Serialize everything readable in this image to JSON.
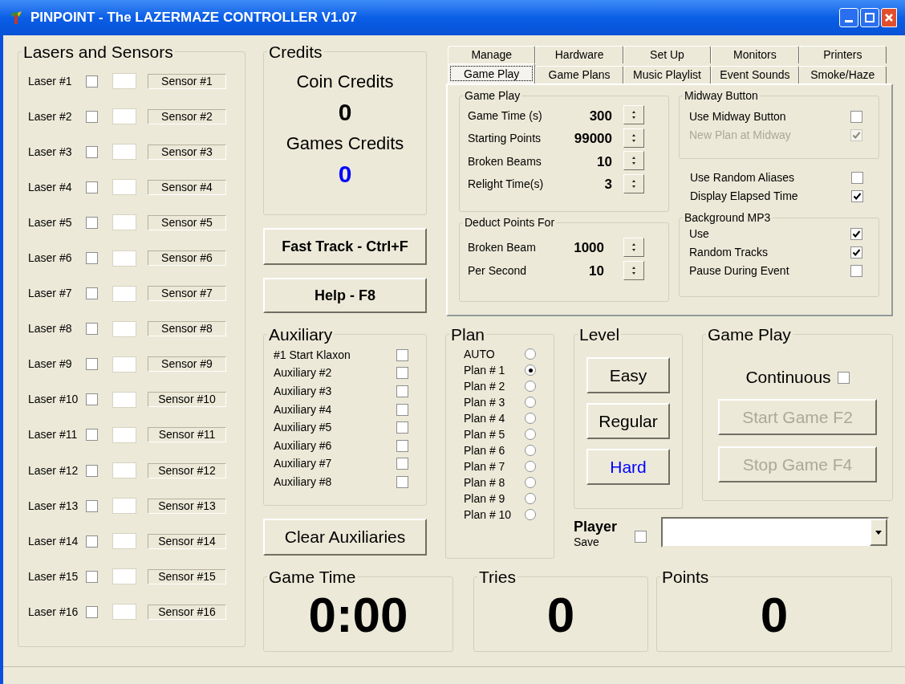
{
  "window": {
    "title": "PINPOINT - The LAZERMAZE CONTROLLER V1.07"
  },
  "lasers_and_sensors": {
    "title": "Lasers and Sensors",
    "rows": [
      {
        "laser": "Laser #1",
        "checked": false,
        "sensor": "Sensor #1"
      },
      {
        "laser": "Laser #2",
        "checked": false,
        "sensor": "Sensor #2"
      },
      {
        "laser": "Laser #3",
        "checked": false,
        "sensor": "Sensor #3"
      },
      {
        "laser": "Laser #4",
        "checked": false,
        "sensor": "Sensor #4"
      },
      {
        "laser": "Laser #5",
        "checked": false,
        "sensor": "Sensor #5"
      },
      {
        "laser": "Laser #6",
        "checked": false,
        "sensor": "Sensor #6"
      },
      {
        "laser": "Laser #7",
        "checked": false,
        "sensor": "Sensor #7"
      },
      {
        "laser": "Laser #8",
        "checked": false,
        "sensor": "Sensor #8"
      },
      {
        "laser": "Laser #9",
        "checked": false,
        "sensor": "Sensor #9"
      },
      {
        "laser": "Laser #10",
        "checked": false,
        "sensor": "Sensor #10"
      },
      {
        "laser": "Laser #11",
        "checked": false,
        "sensor": "Sensor #11"
      },
      {
        "laser": "Laser #12",
        "checked": false,
        "sensor": "Sensor #12"
      },
      {
        "laser": "Laser #13",
        "checked": false,
        "sensor": "Sensor #13"
      },
      {
        "laser": "Laser #14",
        "checked": false,
        "sensor": "Sensor #14"
      },
      {
        "laser": "Laser #15",
        "checked": false,
        "sensor": "Sensor #15"
      },
      {
        "laser": "Laser #16",
        "checked": false,
        "sensor": "Sensor #16"
      }
    ]
  },
  "credits": {
    "title": "Credits",
    "coin_label": "Coin Credits",
    "coin_value": "0",
    "games_label": "Games Credits",
    "games_value": "0"
  },
  "fast_track_button": "Fast Track - Ctrl+F",
  "help_button": "Help - F8",
  "tab_rows": [
    [
      {
        "label": "Manage",
        "selected": false
      },
      {
        "label": "Hardware",
        "selected": false
      },
      {
        "label": "Set Up",
        "selected": false
      },
      {
        "label": "Monitors",
        "selected": false
      },
      {
        "label": "Printers",
        "selected": false
      }
    ],
    [
      {
        "label": "Game Play",
        "selected": true
      },
      {
        "label": "Game Plans",
        "selected": false
      },
      {
        "label": "Music Playlist",
        "selected": false
      },
      {
        "label": "Event Sounds",
        "selected": false
      },
      {
        "label": "Smoke/Haze",
        "selected": false
      }
    ]
  ],
  "tab_panel": {
    "game_play": {
      "title": "Game Play",
      "fields": [
        {
          "label": "Game Time (s)",
          "value": "300"
        },
        {
          "label": "Starting Points",
          "value": "99000"
        },
        {
          "label": "Broken Beams",
          "value": "10"
        },
        {
          "label": "Relight Time(s)",
          "value": "3"
        }
      ]
    },
    "deduct_points": {
      "title": "Deduct Points For",
      "fields": [
        {
          "label": "Broken Beam",
          "value": "1000"
        },
        {
          "label": "Per Second",
          "value": "10"
        }
      ]
    },
    "midway_button": {
      "title": "Midway Button",
      "options": [
        {
          "label": "Use Midway Button",
          "checked": false,
          "disabled": false
        },
        {
          "label": "New Plan at Midway",
          "checked": true,
          "disabled": true
        }
      ]
    },
    "options": [
      {
        "label": "Use Random Aliases",
        "checked": false
      },
      {
        "label": "Display Elapsed Time",
        "checked": true
      }
    ],
    "background_mp3": {
      "title": "Background MP3",
      "options": [
        {
          "label": "Use",
          "checked": true
        },
        {
          "label": "Random Tracks",
          "checked": true
        },
        {
          "label": "Pause During Event",
          "checked": false
        }
      ]
    }
  },
  "auxiliary": {
    "title": "Auxiliary",
    "items": [
      {
        "label": "#1 Start Klaxon",
        "checked": false
      },
      {
        "label": "Auxiliary #2",
        "checked": false
      },
      {
        "label": "Auxiliary #3",
        "checked": false
      },
      {
        "label": "Auxiliary #4",
        "checked": false
      },
      {
        "label": "Auxiliary #5",
        "checked": false
      },
      {
        "label": "Auxiliary #6",
        "checked": false
      },
      {
        "label": "Auxiliary #7",
        "checked": false
      },
      {
        "label": "Auxiliary #8",
        "checked": false
      }
    ]
  },
  "clear_auxiliaries_button": "Clear Auxiliaries",
  "plan": {
    "title": "Plan",
    "items": [
      {
        "label": "AUTO",
        "selected": false
      },
      {
        "label": "Plan # 1",
        "selected": true
      },
      {
        "label": "Plan # 2",
        "selected": false
      },
      {
        "label": "Plan # 3",
        "selected": false
      },
      {
        "label": "Plan # 4",
        "selected": false
      },
      {
        "label": "Plan # 5",
        "selected": false
      },
      {
        "label": "Plan # 6",
        "selected": false
      },
      {
        "label": "Plan # 7",
        "selected": false
      },
      {
        "label": "Plan # 8",
        "selected": false
      },
      {
        "label": "Plan # 9",
        "selected": false
      },
      {
        "label": "Plan # 10",
        "selected": false
      }
    ]
  },
  "level": {
    "title": "Level",
    "buttons": [
      {
        "label": "Easy",
        "selected": false
      },
      {
        "label": "Regular",
        "selected": false
      },
      {
        "label": "Hard",
        "selected": true
      }
    ]
  },
  "game_control": {
    "title": "Game Play",
    "continuous": {
      "label": "Continuous",
      "checked": false
    },
    "buttons": [
      {
        "label": "Start Game F2",
        "disabled": true
      },
      {
        "label": "Stop Game F4",
        "disabled": true
      }
    ]
  },
  "player": {
    "label": "Player",
    "save_label": "Save",
    "save_checked": false
  },
  "scores": [
    {
      "title": "Game Time",
      "value": "0:00"
    },
    {
      "title": "Tries",
      "value": "0"
    },
    {
      "title": "Points",
      "value": "0"
    }
  ]
}
